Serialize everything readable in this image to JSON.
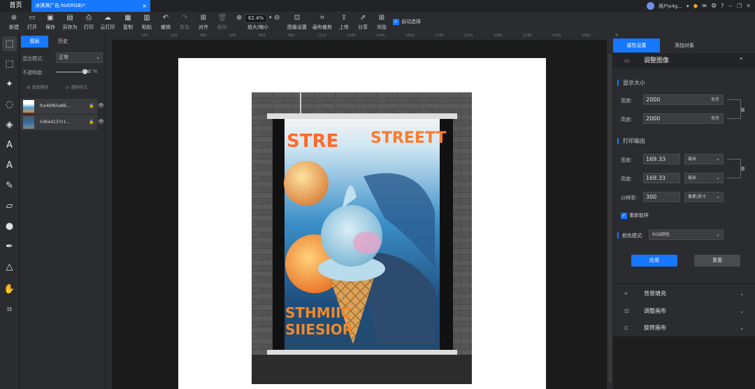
{
  "title_bar": {
    "home": "首页",
    "doc_tab": "冰淇淋广告.hid(RGB)*",
    "close": "×",
    "user": "用户p4g...",
    "user_dropdown": "▾",
    "icons": [
      "gem-icon",
      "mail-icon",
      "settings-icon",
      "help-icon"
    ],
    "win_buttons": [
      "−",
      "❐",
      "✕"
    ]
  },
  "toolbar": {
    "items": [
      {
        "label": "新建",
        "icon": "⊕"
      },
      {
        "label": "打开",
        "icon": "▭"
      },
      {
        "label": "保存",
        "icon": "▣"
      },
      {
        "label": "另存为",
        "icon": "▤"
      },
      {
        "label": "打印",
        "icon": "⎙"
      },
      {
        "label": "云打印",
        "icon": "☁"
      },
      {
        "label": "复制",
        "icon": "▦"
      },
      {
        "label": "粘贴",
        "icon": "▥"
      },
      {
        "label": "撤销",
        "icon": "↶"
      },
      {
        "label": "重做",
        "icon": "↷"
      },
      {
        "label": "对齐",
        "icon": "⊞"
      },
      {
        "label": "删除",
        "icon": "🗑"
      },
      {
        "label": "放大/缩小",
        "icon": ""
      },
      {
        "label": "图像设置",
        "icon": "⊡"
      },
      {
        "label": "画布裁剪",
        "icon": "⌗"
      },
      {
        "label": "上传",
        "icon": "⇪"
      },
      {
        "label": "分享",
        "icon": "⇗"
      },
      {
        "label": "浏览",
        "icon": "⊞"
      }
    ],
    "zoom": "62.4%",
    "zoom_in": "⊕",
    "zoom_out": "⊖",
    "zoom_dropdown": "▾",
    "auto_select": "自动选择"
  },
  "ruler": {
    "h_ticks": [
      "160",
      "320",
      "480",
      "640",
      "800",
      "960",
      "1120",
      "1280",
      "1440",
      "1600",
      "1760",
      "1920",
      "2080",
      "2240",
      "2400",
      "2560"
    ]
  },
  "tools": [
    "selection-tool",
    "marquee-tool",
    "magic-wand-tool",
    "lasso-tool",
    "fill-tool",
    "text-ai-tool",
    "text-tool",
    "brush-tool",
    "eraser-tool",
    "smudge-tool",
    "pen-tool",
    "shape-tool",
    "hand-tool",
    "crop-tool"
  ],
  "tool_glyphs": [
    "⬚",
    "⬚",
    "✦",
    "◌",
    "◈",
    "A",
    "A",
    "✎",
    "▱",
    "●",
    "✒",
    "△",
    "✋",
    "⌗"
  ],
  "layers_panel": {
    "tab_layers": "图层",
    "tab_history": "历史",
    "blend_label": "混合模式:",
    "blend_value": "正常",
    "opacity_label": "不透明度:",
    "opacity_value": "100",
    "opacity_unit": "%",
    "opacity_level": 1.0,
    "clear_fx": "清除删除",
    "clear_style": "清除样式",
    "layers": [
      {
        "name": "fce4bf65e86..."
      },
      {
        "name": "54bed137c1..."
      }
    ],
    "lock_glyph": "🔒",
    "eye_glyph": "👁"
  },
  "right_panel": {
    "tab_props": "属性设置",
    "tab_add": "添加对象",
    "adjust_image": "调整图像",
    "collapse": "⌃",
    "display_size": "显示大小",
    "width_label": "宽度:",
    "height_label": "高度:",
    "display_width": "2000",
    "display_height": "2000",
    "px_unit": "像素",
    "print_output": "打印输出",
    "print_width": "169.33",
    "print_height": "169.33",
    "mm_unit": "毫米",
    "resolution_label": "分辨率:",
    "resolution": "300",
    "resolution_unit": "像素/英寸",
    "resample": "重新取样",
    "color_mode_label": "颜色模式:",
    "color_mode": "RGB颜色",
    "apply": "应用",
    "reset": "重置",
    "sections": [
      {
        "label": "背景填充",
        "icon": "⌗"
      },
      {
        "label": "调整画布",
        "icon": "⊡"
      },
      {
        "label": "旋转画布",
        "icon": "⊏"
      }
    ],
    "expand": "⌄"
  },
  "poster": {
    "headline": "STREETT",
    "headline_left": "STRE",
    "bottom_text_1": "STHMIIC",
    "bottom_text_2": "SIIESIOR"
  }
}
